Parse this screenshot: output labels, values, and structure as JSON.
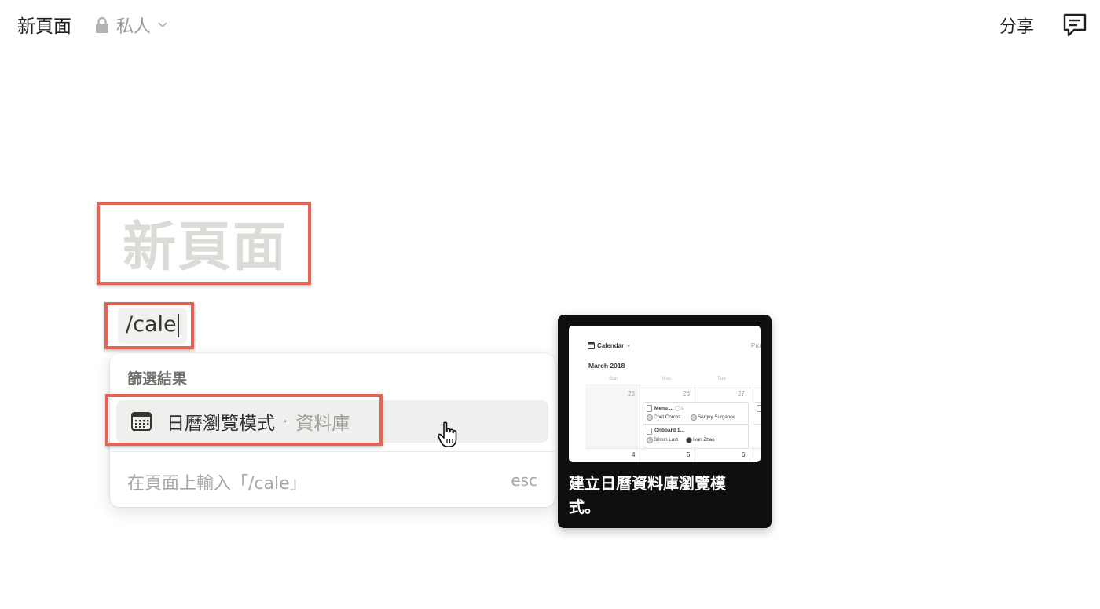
{
  "topbar": {
    "breadcrumb": "新頁面",
    "privacy_label": "私人",
    "share_label": "分享"
  },
  "page": {
    "title_placeholder": "新頁面",
    "command_text": "/cale"
  },
  "menu": {
    "section_title": "篩選結果",
    "items": [
      {
        "label": "日曆瀏覽模式",
        "separator": "·",
        "sublabel": "資料庫",
        "icon": "calendar-icon"
      }
    ],
    "footer_text": "在頁面上輸入「/cale」",
    "footer_shortcut": "esc"
  },
  "preview": {
    "caption": "建立日曆資料庫瀏覽模式。",
    "image": {
      "view_name": "Calendar",
      "clipped_label": "Pro",
      "month": "March 2018",
      "weekdays": [
        "Sun",
        "Mon",
        "Tue"
      ],
      "week1_days": [
        "25",
        "26",
        "27"
      ],
      "week2_days": [
        "4",
        "5",
        "6"
      ],
      "cards": [
        {
          "title": "Menu ...",
          "comment_count": "1",
          "people": [
            "Chet Corcos",
            "Sergey Surganov"
          ]
        },
        {
          "title": "Onboard 1...",
          "people": [
            "Simon Last",
            "Ivan Zhao"
          ]
        }
      ]
    }
  },
  "colors": {
    "highlight_border": "#e46355",
    "title_placeholder": "#dddbd7",
    "menu_item_hover": "#efefed",
    "preview_bg": "#0f0f0f"
  }
}
